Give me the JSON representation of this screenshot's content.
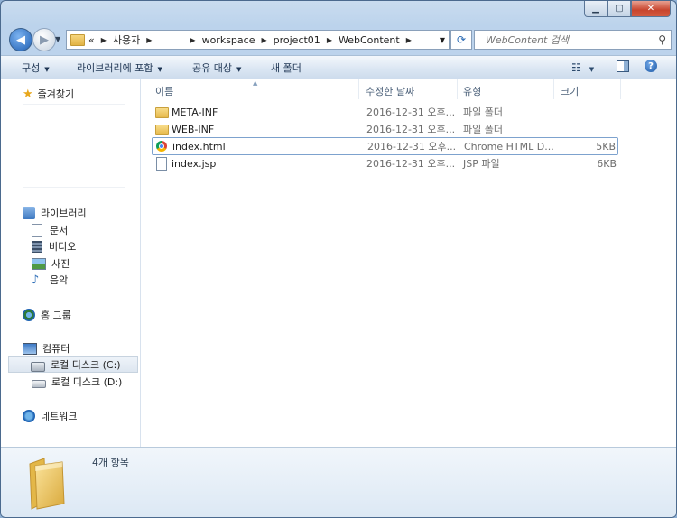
{
  "window": {
    "controls": {
      "minimize": "▁",
      "maximize": "▢",
      "close": "✕"
    }
  },
  "nav": {
    "back": "◀",
    "forward": "▶",
    "history_dropdown": "▼",
    "breadcrumb": [
      "«",
      "사용자",
      "workspace",
      "project01",
      "WebContent"
    ],
    "address_dropdown": "▼",
    "refresh": "⟳",
    "search_placeholder": "WebContent 검색",
    "search_icon": "search-icon"
  },
  "toolbar": {
    "organize": "구성",
    "include_library": "라이브러리에 포함",
    "share": "공유 대상",
    "new_folder": "새 폴더",
    "caret": "▼",
    "view_icon": "☷",
    "help": "?"
  },
  "sidebar": {
    "favorites": "즐겨찾기",
    "libraries": "라이브러리",
    "documents": "문서",
    "videos": "비디오",
    "pictures": "사진",
    "music": "음악",
    "homegroup": "홈 그룹",
    "computer": "컴퓨터",
    "drive_c": "로컬 디스크 (C:)",
    "drive_d": "로컬 디스크 (D:)",
    "network": "네트워크"
  },
  "columns": {
    "name": "이름",
    "modified": "수정한 날짜",
    "type": "유형",
    "size": "크기",
    "sort_arrow": "▲"
  },
  "files": [
    {
      "name": "META-INF",
      "date": "2016-12-31 오후...",
      "type": "파일 폴더",
      "size": "",
      "icon": "folder-icon"
    },
    {
      "name": "WEB-INF",
      "date": "2016-12-31 오후...",
      "type": "파일 폴더",
      "size": "",
      "icon": "folder-icon"
    },
    {
      "name": "index.html",
      "date": "2016-12-31 오후...",
      "type": "Chrome HTML D...",
      "size": "5KB",
      "icon": "chrome-icon"
    },
    {
      "name": "index.jsp",
      "date": "2016-12-31 오후...",
      "type": "JSP 파일",
      "size": "6KB",
      "icon": "document-icon"
    }
  ],
  "details": {
    "item_count": "4개 항목"
  },
  "colors": {
    "chrome_accent": "#7a9cc6",
    "selection_border": "#7da2ce",
    "folder_yellow": "#e5b84a"
  }
}
